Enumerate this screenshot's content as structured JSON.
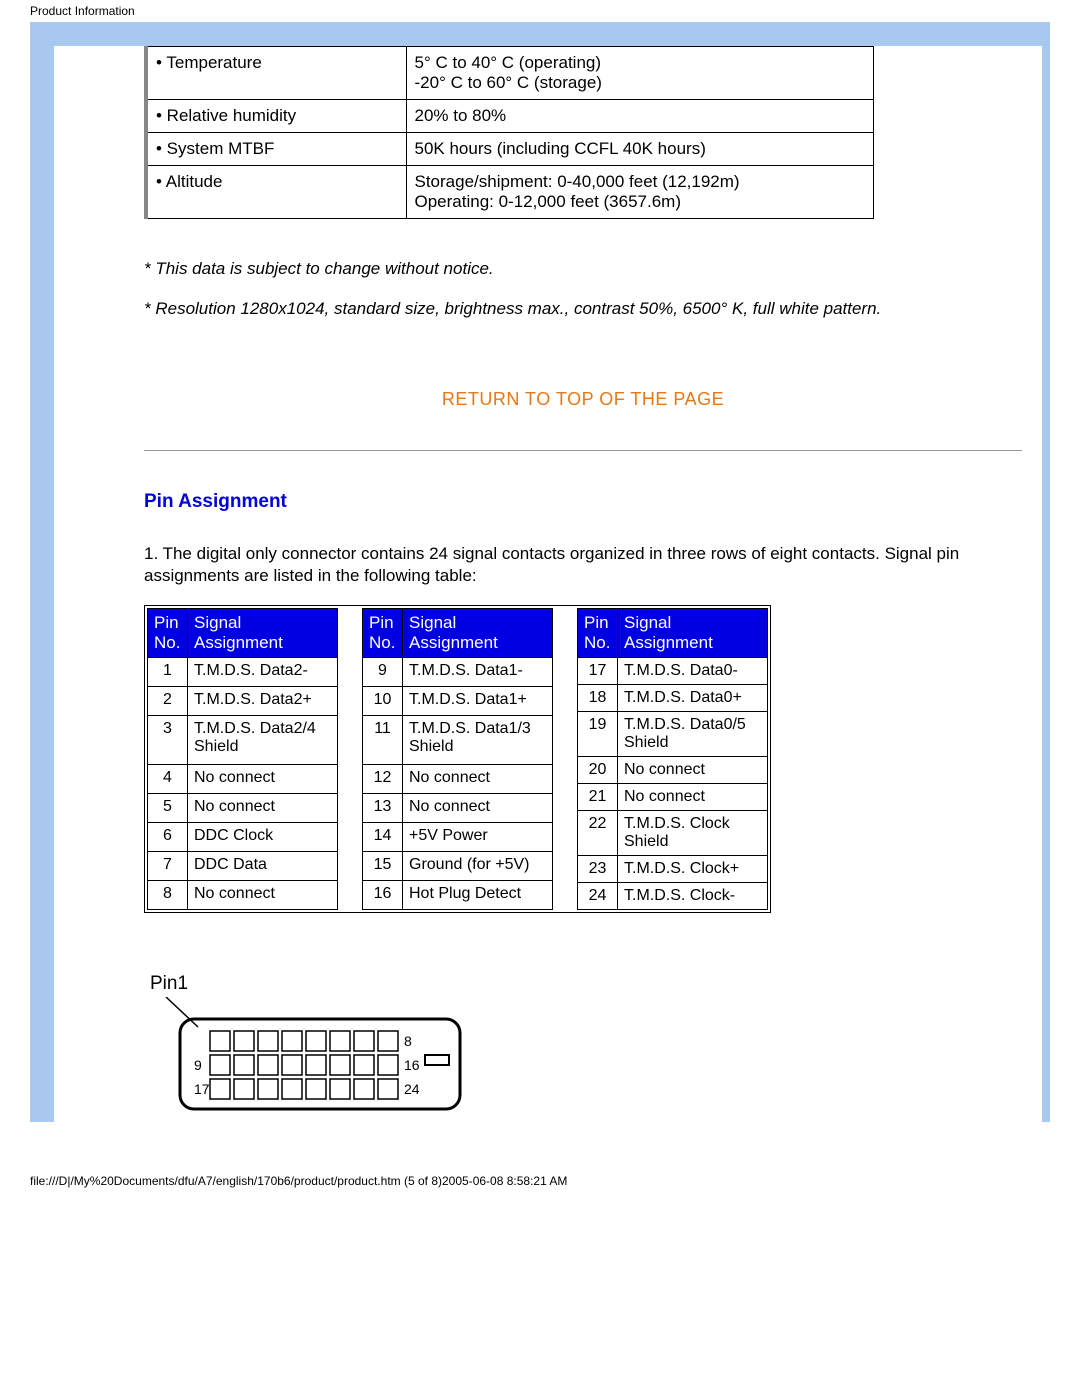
{
  "header": {
    "title": "Product Information"
  },
  "spec_table": {
    "rows": [
      {
        "label": "• Temperature",
        "value": "5° C to 40° C (operating)\n-20° C to 60° C (storage)"
      },
      {
        "label": "• Relative humidity",
        "value": "20% to 80%"
      },
      {
        "label": "• System MTBF",
        "value": "50K hours (including CCFL 40K hours)"
      },
      {
        "label": "• Altitude",
        "value": "Storage/shipment: 0-40,000 feet (12,192m)\nOperating: 0-12,000 feet (3657.6m)"
      }
    ]
  },
  "notes": {
    "line1": "* This data is subject to change without notice.",
    "line2": "* Resolution 1280x1024, standard size, brightness max., contrast 50%, 6500° K, full white pattern."
  },
  "return_link": "RETURN TO TOP OF THE PAGE",
  "section": {
    "title": "Pin Assignment",
    "intro": "1. The digital only connector contains 24 signal contacts organized in three rows of eight contacts. Signal pin assignments are listed in the following table:"
  },
  "pin_headers": {
    "col1": "Pin No.",
    "col2": "Signal Assignment"
  },
  "pin_tables": [
    [
      {
        "pin": "1",
        "sig": "T.M.D.S. Data2-"
      },
      {
        "pin": "2",
        "sig": "T.M.D.S. Data2+"
      },
      {
        "pin": "3",
        "sig": "T.M.D.S. Data2/4 Shield"
      },
      {
        "pin": "4",
        "sig": "No connect"
      },
      {
        "pin": "5",
        "sig": "No connect"
      },
      {
        "pin": "6",
        "sig": "DDC Clock"
      },
      {
        "pin": "7",
        "sig": "DDC Data"
      },
      {
        "pin": "8",
        "sig": "No connect"
      }
    ],
    [
      {
        "pin": "9",
        "sig": "T.M.D.S. Data1-"
      },
      {
        "pin": "10",
        "sig": "T.M.D.S. Data1+"
      },
      {
        "pin": "11",
        "sig": "T.M.D.S. Data1/3 Shield"
      },
      {
        "pin": "12",
        "sig": "No connect"
      },
      {
        "pin": "13",
        "sig": "No connect"
      },
      {
        "pin": "14",
        "sig": "+5V Power"
      },
      {
        "pin": "15",
        "sig": "Ground (for +5V)"
      },
      {
        "pin": "16",
        "sig": "Hot Plug Detect"
      }
    ],
    [
      {
        "pin": "17",
        "sig": "T.M.D.S. Data0-"
      },
      {
        "pin": "18",
        "sig": "T.M.D.S. Data0+"
      },
      {
        "pin": "19",
        "sig": "T.M.D.S. Data0/5 Shield"
      },
      {
        "pin": "20",
        "sig": "No connect"
      },
      {
        "pin": "21",
        "sig": "No connect"
      },
      {
        "pin": "22",
        "sig": "T.M.D.S. Clock Shield"
      },
      {
        "pin": "23",
        "sig": "T.M.D.S. Clock+"
      },
      {
        "pin": "24",
        "sig": "T.M.D.S. Clock-"
      }
    ]
  ],
  "diagram": {
    "label": "Pin1",
    "row_end_labels": [
      "8",
      "16",
      "24"
    ],
    "row_start_labels": [
      "",
      "9",
      "17"
    ]
  },
  "footer": {
    "text": "file:///D|/My%20Documents/dfu/A7/english/170b6/product/product.htm (5 of 8)2005-06-08 8:58:21 AM"
  }
}
